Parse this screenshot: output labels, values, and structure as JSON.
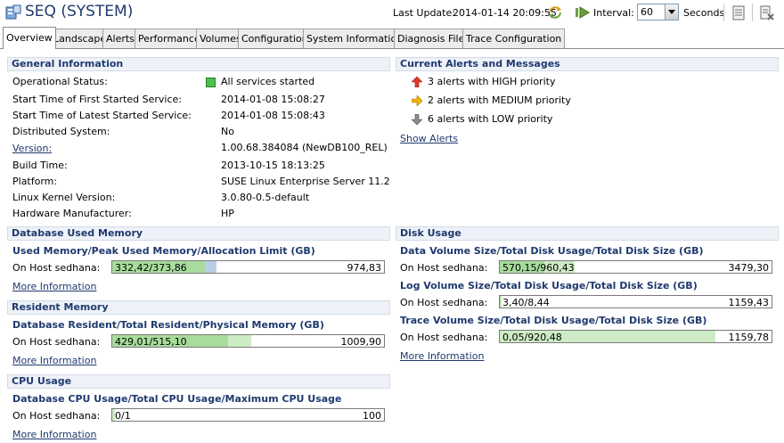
{
  "header": {
    "title": "SEQ (SYSTEM)",
    "last_update_label": "Last Update:",
    "last_update_value": "2014-01-14 20:09:55",
    "interval_label": "Interval:",
    "interval_value": "60",
    "seconds_label": "Seconds"
  },
  "tabs": [
    {
      "label": "Overview",
      "active": true
    },
    {
      "label": "Landscape"
    },
    {
      "label": "Alerts"
    },
    {
      "label": "Performance"
    },
    {
      "label": "Volumes"
    },
    {
      "label": "Configuration"
    },
    {
      "label": "System Information"
    },
    {
      "label": "Diagnosis Files"
    },
    {
      "label": "Trace Configuration"
    }
  ],
  "general": {
    "title": "General Information",
    "rows": [
      {
        "label": "Operational Status:",
        "value": "All services started"
      },
      {
        "label": "Start Time of First Started Service:",
        "value": "2014-01-08 15:08:27"
      },
      {
        "label": "Start Time of Latest Started Service:",
        "value": "2014-01-08 15:08:43"
      },
      {
        "label": "Distributed System:",
        "value": "No"
      },
      {
        "label": "Version:",
        "value": "1.00.68.384084 (NewDB100_REL)"
      },
      {
        "label": "Build Time:",
        "value": "2013-10-15 18:13:25"
      },
      {
        "label": "Platform:",
        "value": "SUSE Linux Enterprise Server 11.2"
      },
      {
        "label": "Linux Kernel Version:",
        "value": "3.0.80-0.5-default"
      },
      {
        "label": "Hardware Manufacturer:",
        "value": "HP"
      }
    ]
  },
  "alerts": {
    "title": "Current Alerts and Messages",
    "items": [
      {
        "text": "3 alerts with HIGH priority",
        "color": "#e03a2a"
      },
      {
        "text": "2 alerts with MEDIUM priority",
        "color": "#f0b400"
      },
      {
        "text": "6 alerts with LOW priority",
        "color": "#8a8a8a"
      }
    ],
    "show_link": "Show Alerts"
  },
  "memory": {
    "title": "Database Used Memory",
    "subtitle": "Used Memory/Peak Used Memory/Allocation Limit (GB)",
    "host_label": "On Host sedhana:",
    "bar_left": "332,42/373,86",
    "bar_right": "974,83",
    "used_fraction": 0.341,
    "peak_fraction": 0.384,
    "more_link": "More Information"
  },
  "resident": {
    "title": "Resident Memory",
    "subtitle": "Database Resident/Total Resident/Physical Memory (GB)",
    "host_label": "On Host sedhana:",
    "bar_left": "429,01/515,10",
    "bar_right": "1009,90",
    "db_fraction": 0.425,
    "total_fraction": 0.51,
    "more_link": "More Information"
  },
  "cpu": {
    "title": "CPU Usage",
    "subtitle": "Database CPU Usage/Total CPU Usage/Maximum CPU Usage",
    "host_label": "On Host sedhana:",
    "bar_left": "0/1",
    "bar_right": "100",
    "db_fraction": 0.0,
    "total_fraction": 0.01,
    "more_link": "More Information"
  },
  "disk": {
    "title": "Disk Usage",
    "data": {
      "subtitle": "Data Volume Size/Total Disk Usage/Total Disk Size (GB)",
      "host_label": "On Host sedhana:",
      "bar_left": "570,15/960,43",
      "bar_right": "3479,30",
      "vol_fraction": 0.164,
      "usage_fraction": 0.276
    },
    "log": {
      "subtitle": "Log Volume Size/Total Disk Usage/Total Disk Size (GB)",
      "host_label": "On Host sedhana:",
      "bar_left": "3,40/8,44",
      "bar_right": "1159,43",
      "vol_fraction": 0.003,
      "usage_fraction": 0.007
    },
    "trace": {
      "subtitle": "Trace Volume Size/Total Disk Usage/Total Disk Size (GB)",
      "host_label": "On Host sedhana:",
      "bar_left": "0,05/920,48",
      "bar_right": "1159,78",
      "vol_fraction": 0.0,
      "usage_fraction": 0.794
    },
    "more_link": "More Information"
  }
}
